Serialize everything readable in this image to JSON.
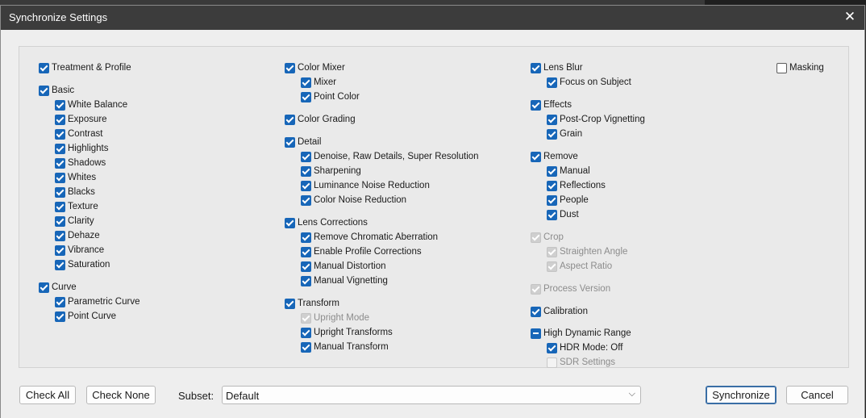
{
  "dialog": {
    "title": "Synchronize Settings"
  },
  "columns": [
    {
      "items": [
        {
          "label": "Treatment & Profile",
          "state": "checked",
          "level": 0,
          "row": 0
        },
        {
          "label": "Basic",
          "state": "checked",
          "level": 0,
          "row": 1.55
        },
        {
          "label": "White Balance",
          "state": "checked",
          "level": 1,
          "row": 2.55
        },
        {
          "label": "Exposure",
          "state": "checked",
          "level": 1,
          "row": 3.55
        },
        {
          "label": "Contrast",
          "state": "checked",
          "level": 1,
          "row": 4.55
        },
        {
          "label": "Highlights",
          "state": "checked",
          "level": 1,
          "row": 5.55
        },
        {
          "label": "Shadows",
          "state": "checked",
          "level": 1,
          "row": 6.55
        },
        {
          "label": "Whites",
          "state": "checked",
          "level": 1,
          "row": 7.55
        },
        {
          "label": "Blacks",
          "state": "checked",
          "level": 1,
          "row": 8.55
        },
        {
          "label": "Texture",
          "state": "checked",
          "level": 1,
          "row": 9.55
        },
        {
          "label": "Clarity",
          "state": "checked",
          "level": 1,
          "row": 10.55
        },
        {
          "label": "Dehaze",
          "state": "checked",
          "level": 1,
          "row": 11.55
        },
        {
          "label": "Vibrance",
          "state": "checked",
          "level": 1,
          "row": 12.55
        },
        {
          "label": "Saturation",
          "state": "checked",
          "level": 1,
          "row": 13.55
        },
        {
          "label": "Curve",
          "state": "checked",
          "level": 0,
          "row": 15.1
        },
        {
          "label": "Parametric Curve",
          "state": "checked",
          "level": 1,
          "row": 16.1
        },
        {
          "label": "Point Curve",
          "state": "checked",
          "level": 1,
          "row": 17.1
        }
      ]
    },
    {
      "items": [
        {
          "label": "Color Mixer",
          "state": "checked",
          "level": 0,
          "row": 0
        },
        {
          "label": "Mixer",
          "state": "checked",
          "level": 1,
          "row": 1
        },
        {
          "label": "Point Color",
          "state": "checked",
          "level": 1,
          "row": 2
        },
        {
          "label": "Color Grading",
          "state": "checked",
          "level": 0,
          "row": 3.55
        },
        {
          "label": "Detail",
          "state": "checked",
          "level": 0,
          "row": 5.1
        },
        {
          "label": "Denoise, Raw Details, Super Resolution",
          "state": "checked",
          "level": 1,
          "row": 6.1
        },
        {
          "label": "Sharpening",
          "state": "checked",
          "level": 1,
          "row": 7.1
        },
        {
          "label": "Luminance Noise Reduction",
          "state": "checked",
          "level": 1,
          "row": 8.1
        },
        {
          "label": "Color Noise Reduction",
          "state": "checked",
          "level": 1,
          "row": 9.1
        },
        {
          "label": "Lens Corrections",
          "state": "checked",
          "level": 0,
          "row": 10.65
        },
        {
          "label": "Remove Chromatic Aberration",
          "state": "checked",
          "level": 1,
          "row": 11.65
        },
        {
          "label": "Enable Profile Corrections",
          "state": "checked",
          "level": 1,
          "row": 12.65
        },
        {
          "label": "Manual Distortion",
          "state": "checked",
          "level": 1,
          "row": 13.65
        },
        {
          "label": "Manual Vignetting",
          "state": "checked",
          "level": 1,
          "row": 14.65
        },
        {
          "label": "Transform",
          "state": "checked",
          "level": 0,
          "row": 16.2
        },
        {
          "label": "Upright Mode",
          "state": "checked-disabled",
          "level": 1,
          "row": 17.2
        },
        {
          "label": "Upright Transforms",
          "state": "checked",
          "level": 1,
          "row": 18.2
        },
        {
          "label": "Manual Transform",
          "state": "checked",
          "level": 1,
          "row": 19.2
        }
      ]
    },
    {
      "items": [
        {
          "label": "Lens Blur",
          "state": "checked",
          "level": 0,
          "row": 0
        },
        {
          "label": "Focus on Subject",
          "state": "checked",
          "level": 1,
          "row": 1
        },
        {
          "label": "Effects",
          "state": "checked",
          "level": 0,
          "row": 2.55
        },
        {
          "label": "Post-Crop Vignetting",
          "state": "checked",
          "level": 1,
          "row": 3.55
        },
        {
          "label": "Grain",
          "state": "checked",
          "level": 1,
          "row": 4.55
        },
        {
          "label": "Remove",
          "state": "checked",
          "level": 0,
          "row": 6.1
        },
        {
          "label": "Manual",
          "state": "checked",
          "level": 1,
          "row": 7.1
        },
        {
          "label": "Reflections",
          "state": "checked",
          "level": 1,
          "row": 8.1
        },
        {
          "label": "People",
          "state": "checked",
          "level": 1,
          "row": 9.1
        },
        {
          "label": "Dust",
          "state": "checked",
          "level": 1,
          "row": 10.1
        },
        {
          "label": "Crop",
          "state": "checked-disabled",
          "level": 0,
          "row": 11.65
        },
        {
          "label": "Straighten Angle",
          "state": "checked-disabled",
          "level": 1,
          "row": 12.65
        },
        {
          "label": "Aspect Ratio",
          "state": "checked-disabled",
          "level": 1,
          "row": 13.65
        },
        {
          "label": "Process Version",
          "state": "checked-disabled",
          "level": 0,
          "row": 15.2
        },
        {
          "label": "Calibration",
          "state": "checked",
          "level": 0,
          "row": 16.75
        },
        {
          "label": "High Dynamic Range",
          "state": "indeterminate",
          "level": 0,
          "row": 18.3
        },
        {
          "label": "HDR Mode: Off",
          "state": "checked",
          "level": 1,
          "row": 19.3
        },
        {
          "label": "SDR Settings",
          "state": "unchecked-disabled",
          "level": 1,
          "row": 20.3
        }
      ]
    },
    {
      "items": [
        {
          "label": "Masking",
          "state": "unchecked",
          "level": 0,
          "row": 0
        }
      ]
    }
  ],
  "footer": {
    "check_all": "Check All",
    "check_none": "Check None",
    "subset_label": "Subset:",
    "subset_value": "Default",
    "synchronize": "Synchronize",
    "cancel": "Cancel"
  }
}
